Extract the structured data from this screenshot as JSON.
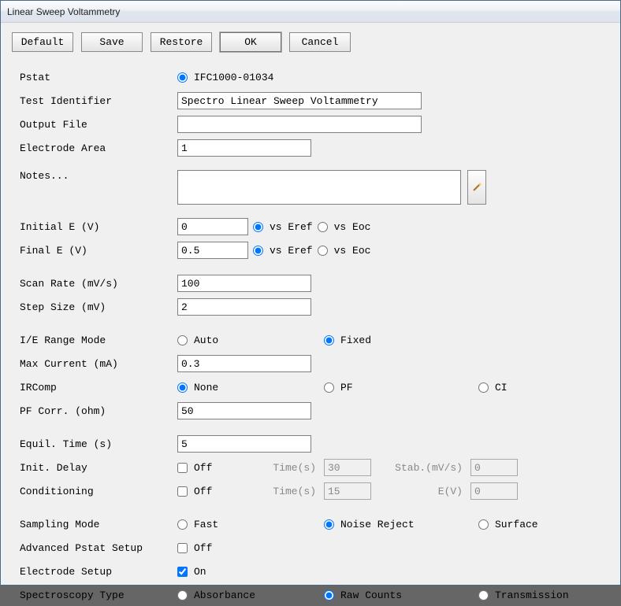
{
  "window": {
    "title": "Linear Sweep Voltammetry"
  },
  "buttons": {
    "default": "Default",
    "save": "Save",
    "restore": "Restore",
    "ok": "OK",
    "cancel": "Cancel"
  },
  "labels": {
    "pstat": "Pstat",
    "test_identifier": "Test Identifier",
    "output_file": "Output File",
    "electrode_area": "Electrode Area",
    "notes": "Notes...",
    "initial_e": "Initial E (V)",
    "final_e": "Final E (V)",
    "scan_rate": "Scan Rate (mV/s)",
    "step_size": "Step Size (mV)",
    "ie_range_mode": "I/E Range Mode",
    "max_current": "Max Current (mA)",
    "ircomp": "IRComp",
    "pf_corr": "PF Corr. (ohm)",
    "equil_time": "Equil. Time (s)",
    "init_delay": "Init. Delay",
    "conditioning": "Conditioning",
    "sampling_mode": "Sampling Mode",
    "advanced_pstat": "Advanced Pstat Setup",
    "electrode_setup": "Electrode Setup",
    "spectroscopy_type": "Spectroscopy Type"
  },
  "pstat_option": "IFC1000-01034",
  "values": {
    "test_identifier": "Spectro Linear Sweep Voltammetry",
    "output_file": "",
    "electrode_area": "1",
    "notes": "",
    "initial_e": "0",
    "final_e": "0.5",
    "scan_rate": "100",
    "step_size": "2",
    "max_current": "0.3",
    "pf_corr": "50",
    "equil_time": "5",
    "init_delay_time": "30",
    "init_delay_stab": "0",
    "conditioning_time": "15",
    "conditioning_ev": "0"
  },
  "radio": {
    "vs_eref": "vs Eref",
    "vs_eoc": "vs Eoc",
    "auto": "Auto",
    "fixed": "Fixed",
    "none": "None",
    "pf": "PF",
    "ci": "CI",
    "fast": "Fast",
    "noise_reject": "Noise Reject",
    "surface": "Surface",
    "absorbance": "Absorbance",
    "raw_counts": "Raw Counts",
    "transmission": "Transmission"
  },
  "check": {
    "off": "Off",
    "on": "On"
  },
  "sublabels": {
    "time_s": "Time(s)",
    "stab": "Stab.(mV/s)",
    "ev": "E(V)"
  }
}
